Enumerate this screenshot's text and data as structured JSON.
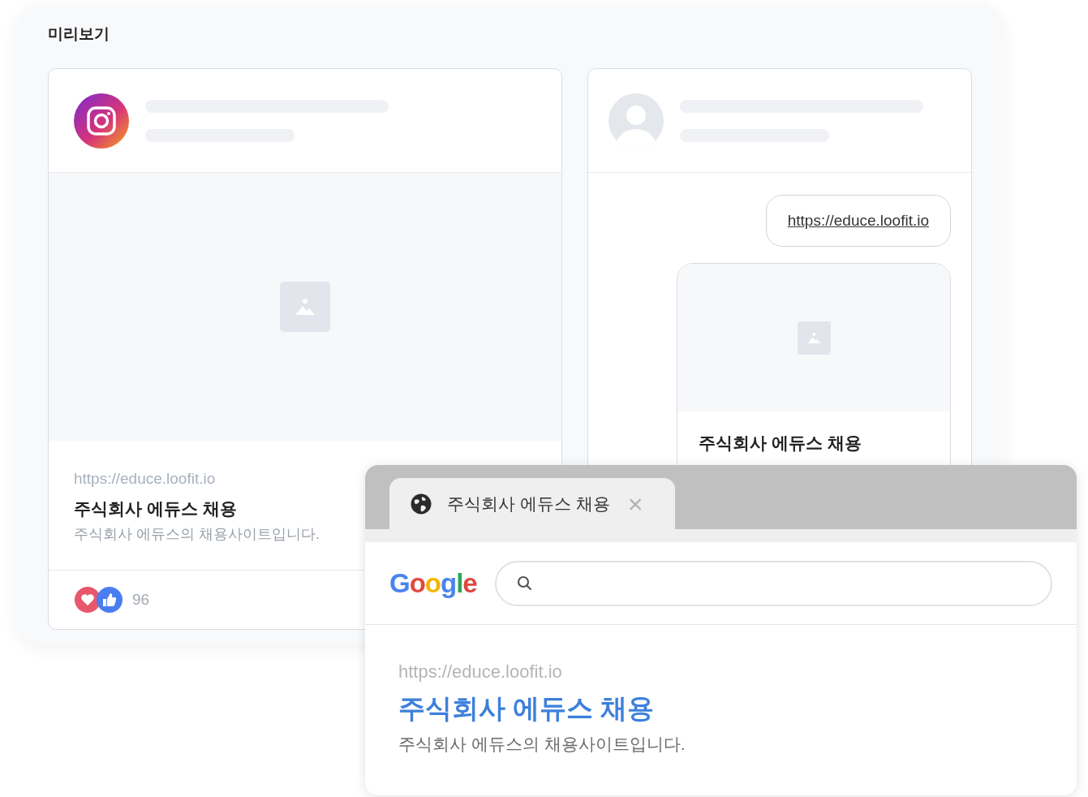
{
  "panel": {
    "title": "미리보기"
  },
  "instagram_post": {
    "url": "https://educe.loofit.io",
    "title": "주식회사 에듀스 채용",
    "description": "주식회사 에듀스의 채용사이트입니다.",
    "reaction_count": "96"
  },
  "message_preview": {
    "link": "https://educe.loofit.io",
    "card_title": "주식회사 에듀스 채용"
  },
  "browser": {
    "tab_title": "주식회사 에듀스 채용",
    "close": "×",
    "logo": "Google",
    "result": {
      "url": "https://educe.loofit.io",
      "title": "주식회사 에듀스 채용",
      "description": "주식회사 에듀스의 채용사이트입니다."
    }
  }
}
